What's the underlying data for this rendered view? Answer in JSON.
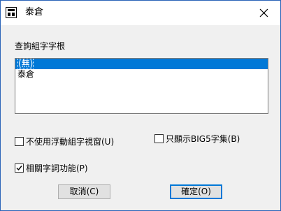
{
  "window": {
    "title": "泰倉"
  },
  "dialog": {
    "list_label": "查詢組字字根",
    "list_items": [
      "(無)",
      "泰倉"
    ],
    "checkbox_floating": {
      "label": "不使用浮動組字視窗(U)",
      "checked": false
    },
    "checkbox_big5": {
      "label": "只顯示BIG5字集(B)",
      "checked": false
    },
    "checkbox_related": {
      "label": "相關字詞功能(P)",
      "checked": true
    },
    "cancel_label": "取消(C)",
    "ok_label": "確定(O)"
  },
  "colors": {
    "selection": "#0078d7",
    "border": "#2b64b8"
  },
  "icons": {
    "app": "app-icon",
    "close": "close-icon",
    "check": "check-icon"
  }
}
